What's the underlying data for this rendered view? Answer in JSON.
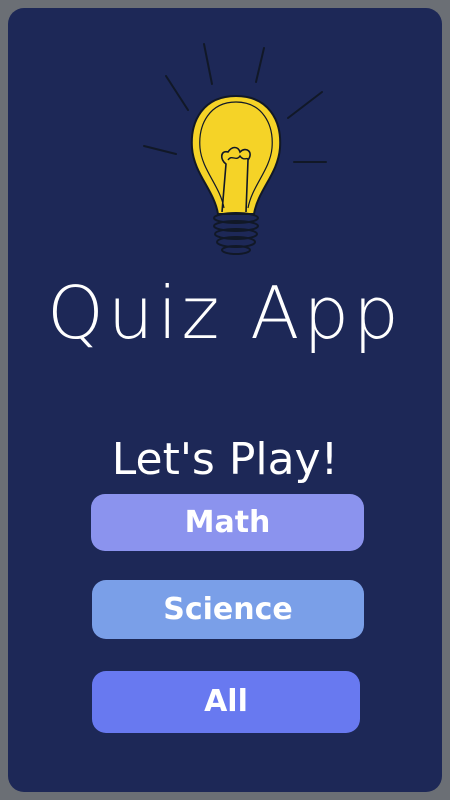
{
  "app": {
    "title": "Quiz App",
    "subtitle": "Let's Play!"
  },
  "logo": {
    "icon": "lightbulb-icon"
  },
  "buttons": {
    "math": "Math",
    "science": "Science",
    "all": "All"
  },
  "colors": {
    "background": "#1d2857",
    "frame": "#6b6f75",
    "bulb": "#f5d327",
    "math_button": "#8b93ee",
    "science_button": "#7a9fe8",
    "all_button": "#6879f0"
  }
}
